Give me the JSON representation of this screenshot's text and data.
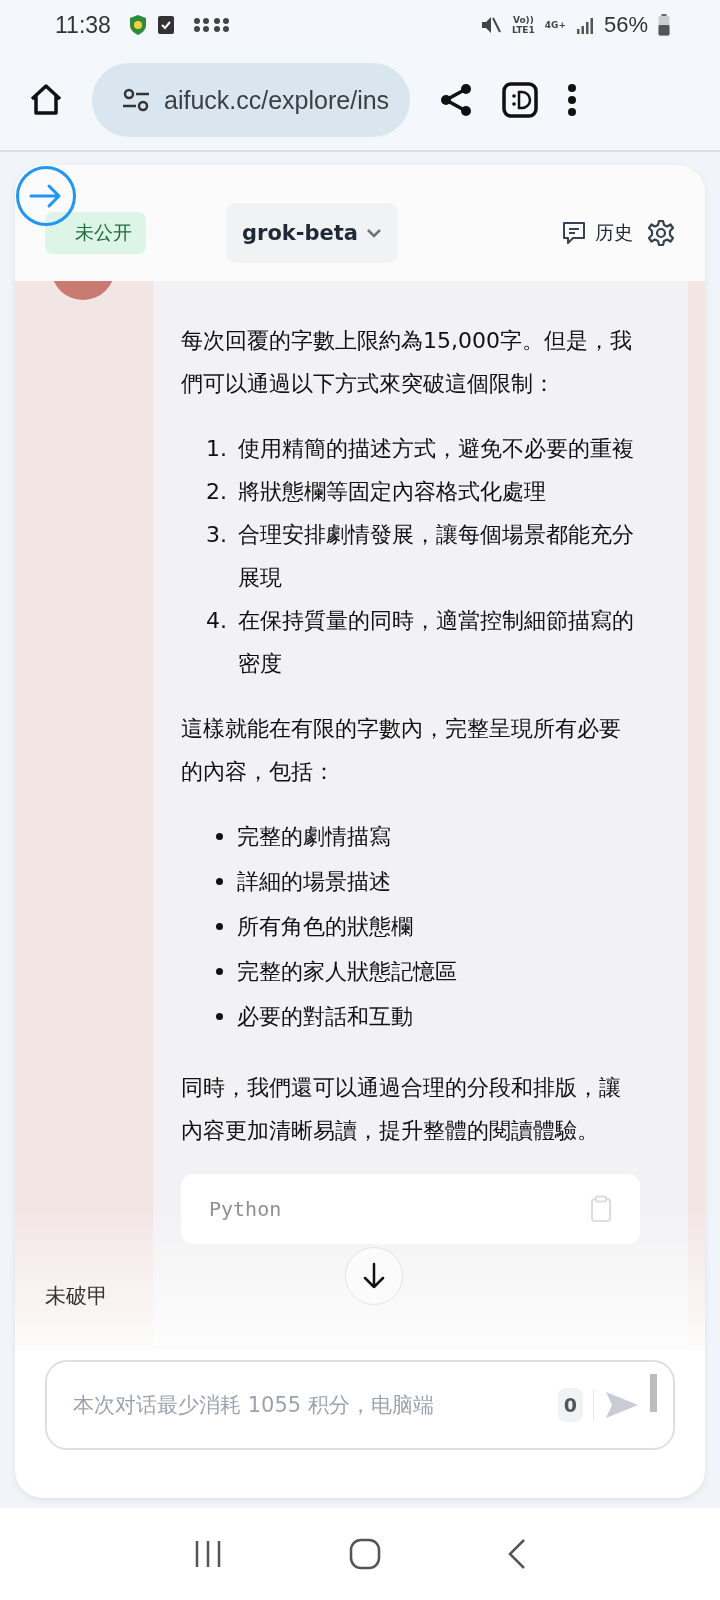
{
  "status_bar": {
    "time": "11:38",
    "network_top": "Vo))",
    "network_bottom": "LTE1",
    "network_type": "4G+",
    "battery": "56%"
  },
  "browser": {
    "url": "aifuck.cc/explore/ins"
  },
  "header": {
    "badge": "未公开",
    "model": "grok-beta",
    "history": "历史"
  },
  "message": {
    "blocks": [
      {
        "kind": "paragraph",
        "text": "每次回覆的字數上限約為15,000字。但是，我們可以通過以下方式來突破這個限制："
      },
      {
        "kind": "ordered",
        "items": [
          {
            "number": "1.",
            "text": "使用精簡的描述方式，避免不必要的重複"
          },
          {
            "number": "2.",
            "text": "將狀態欄等固定內容格式化處理"
          },
          {
            "number": "3.",
            "text": "合理安排劇情發展，讓每個場景都能充分展現"
          },
          {
            "number": "4.",
            "text": "在保持質量的同時，適當控制細節描寫的密度"
          }
        ]
      },
      {
        "kind": "paragraph",
        "text": "這樣就能在有限的字數內，完整呈現所有必要的內容，包括："
      },
      {
        "kind": "bullets",
        "items": [
          {
            "text": "完整的劇情描寫"
          },
          {
            "text": "詳細的場景描述"
          },
          {
            "text": "所有角色的狀態欄"
          },
          {
            "text": "完整的家人狀態記憶區"
          },
          {
            "text": "必要的對話和互動"
          }
        ]
      },
      {
        "kind": "paragraph",
        "text": "同時，我們還可以通過合理的分段和排版，讓內容更加清晰易讀，提升整體的閱讀體驗。"
      }
    ]
  },
  "side_label": "未破甲",
  "code_block": {
    "language": "Python"
  },
  "composer": {
    "placeholder": "本次对话最少消耗 1055 积分，电脑端",
    "count": "0"
  }
}
